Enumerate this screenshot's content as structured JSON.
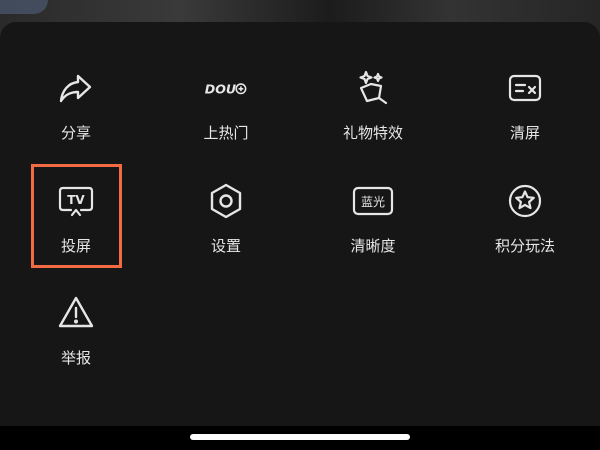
{
  "menu": {
    "items": [
      {
        "label": "分享",
        "icon": "share-arrow-icon"
      },
      {
        "label": "上热门",
        "icon": "dou-plus-icon"
      },
      {
        "label": "礼物特效",
        "icon": "gift-effect-icon"
      },
      {
        "label": "清屏",
        "icon": "clear-screen-icon"
      },
      {
        "label": "投屏",
        "icon": "tv-cast-icon"
      },
      {
        "label": "设置",
        "icon": "settings-hexagon-icon"
      },
      {
        "label": "清晰度",
        "icon": "resolution-icon"
      },
      {
        "label": "积分玩法",
        "icon": "points-star-icon"
      },
      {
        "label": "举报",
        "icon": "report-warning-icon"
      }
    ]
  },
  "icon_text": {
    "dou": "DOU",
    "tv": "TV",
    "lanGuang": "蓝光"
  },
  "colors": {
    "panel": "#161616",
    "highlight": "#f26b43",
    "text": "#e6e6e6"
  }
}
